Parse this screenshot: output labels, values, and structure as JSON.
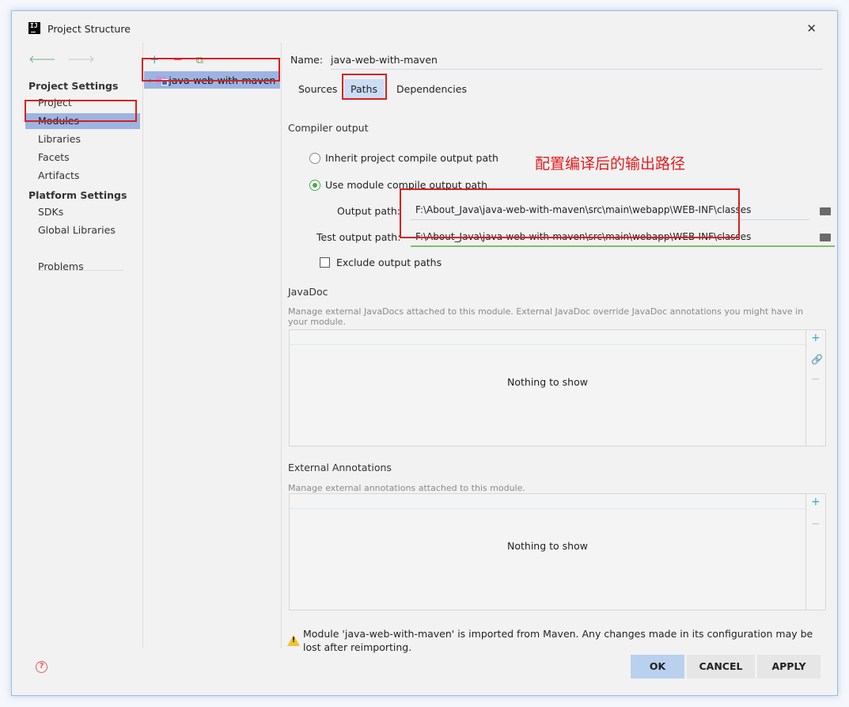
{
  "window": {
    "title": "Project Structure",
    "close_glyph": "✕"
  },
  "nav": {
    "back_glyph": "🡐",
    "fwd_glyph": "🡒",
    "project_settings_header": "Project Settings",
    "project_items": [
      "Project",
      "Modules",
      "Libraries",
      "Facets",
      "Artifacts"
    ],
    "platform_settings_header": "Platform Settings",
    "platform_items": [
      "SDKs",
      "Global Libraries"
    ],
    "problems": "Problems",
    "selected": "Modules"
  },
  "tree": {
    "add_glyph": "+",
    "remove_glyph": "−",
    "copy_glyph": "⧉",
    "chevron": "›",
    "module_name": "java-web-with-maven"
  },
  "module": {
    "name_label": "Name:",
    "name_value": "java-web-with-maven",
    "tabs": [
      "Sources",
      "Paths",
      "Dependencies"
    ],
    "active_tab": "Paths",
    "compiler_output_title": "Compiler output",
    "radio_inherit": "Inherit project compile output path",
    "radio_use_module": "Use module compile output path",
    "output_path_label": "Output path:",
    "output_path_value": "F:\\About_Java\\java-web-with-maven\\src\\main\\webapp\\WEB-INF\\classes",
    "test_output_path_label": "Test output path:",
    "test_output_path_value": "F:\\About_Java\\java-web-with-maven\\src\\main\\webapp\\WEB-INF\\classes",
    "exclude_output_paths": "Exclude output paths",
    "javadoc_title": "JavaDoc",
    "javadoc_desc": "Manage external JavaDocs attached to this module. External JavaDoc override JavaDoc annotations you might have in your module.",
    "javadoc_empty": "Nothing to show",
    "ext_ann_title": "External Annotations",
    "ext_ann_desc": "Manage external annotations attached to this module.",
    "ext_ann_empty": "Nothing to show",
    "warning": "Module 'java-web-with-maven' is imported from Maven. Any changes made in its configuration may be lost after reimporting."
  },
  "side_buttons": {
    "add": "+",
    "link": "🔗",
    "remove": "−"
  },
  "buttons": {
    "ok": "OK",
    "cancel": "CANCEL",
    "apply": "APPLY",
    "help": "?"
  },
  "annotation_text": "配置编译后的输出路径",
  "colors": {
    "selection": "#9db4e2",
    "annotation_red": "#d62020",
    "radio_green": "#4aa84f"
  }
}
